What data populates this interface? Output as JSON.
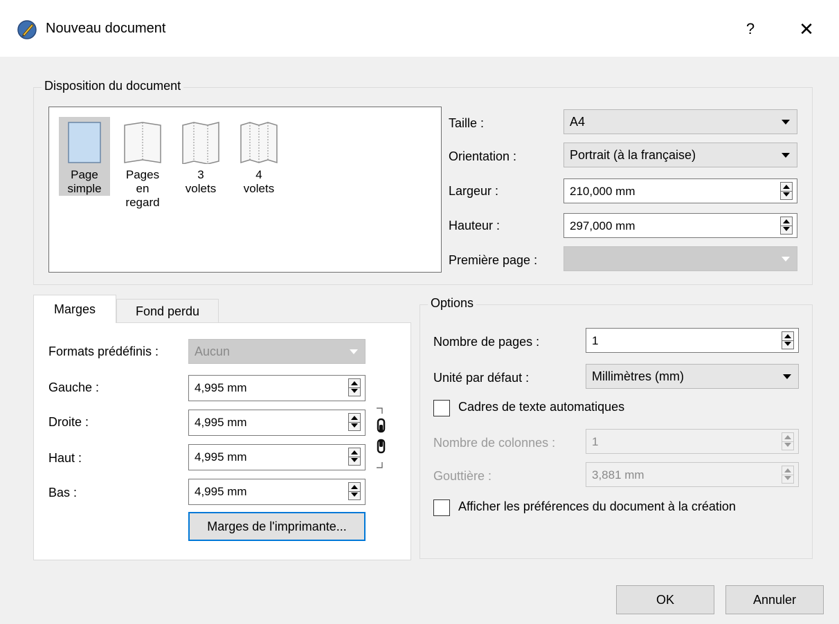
{
  "window": {
    "title": "Nouveau document",
    "help_label": "?",
    "close_label": "✕"
  },
  "layout_group": {
    "title": "Disposition du document",
    "items": [
      {
        "label": "Page\nsimple",
        "selected": true,
        "icon": "single-page-icon"
      },
      {
        "label": "Pages\nen\nregard",
        "selected": false,
        "icon": "facing-pages-icon"
      },
      {
        "label": "3\nvolets",
        "selected": false,
        "icon": "three-fold-icon"
      },
      {
        "label": "4\nvolets",
        "selected": false,
        "icon": "four-fold-icon"
      }
    ],
    "size_label": "Taille :",
    "size_value": "A4",
    "orientation_label": "Orientation :",
    "orientation_value": "Portrait (à la française)",
    "width_label": "Largeur :",
    "width_value": "210,000 mm",
    "height_label": "Hauteur :",
    "height_value": "297,000 mm",
    "first_page_label": "Première page  :",
    "first_page_value": ""
  },
  "tabs": [
    {
      "label": "Marges",
      "active": true
    },
    {
      "label": "Fond perdu",
      "active": false
    }
  ],
  "margins": {
    "presets_label": "Formats prédéfinis :",
    "presets_value": "Aucun",
    "left_label": "Gauche :",
    "left_value": "4,995 mm",
    "right_label": "Droite :",
    "right_value": "4,995 mm",
    "top_label": "Haut :",
    "top_value": "4,995 mm",
    "bottom_label": "Bas :",
    "bottom_value": "4,995 mm",
    "printer_margins_button": "Marges de l'imprimante..."
  },
  "options": {
    "title": "Options",
    "pages_label": "Nombre de pages :",
    "pages_value": "1",
    "unit_label": "Unité par défaut :",
    "unit_value": "Millimètres (mm)",
    "auto_frames_label": "Cadres de texte automatiques",
    "auto_frames_checked": false,
    "columns_label": "Nombre de colonnes :",
    "columns_value": "1",
    "gutter_label": "Gouttière :",
    "gutter_value": "3,881 mm",
    "show_prefs_label": "Afficher les préférences du document à la création",
    "show_prefs_checked": false
  },
  "buttons": {
    "ok": "OK",
    "cancel": "Annuler"
  },
  "colors": {
    "selection_fill": "#cfcfcf",
    "page_thumb_selected": "#c5dcf2",
    "focus_border": "#0078d7"
  }
}
